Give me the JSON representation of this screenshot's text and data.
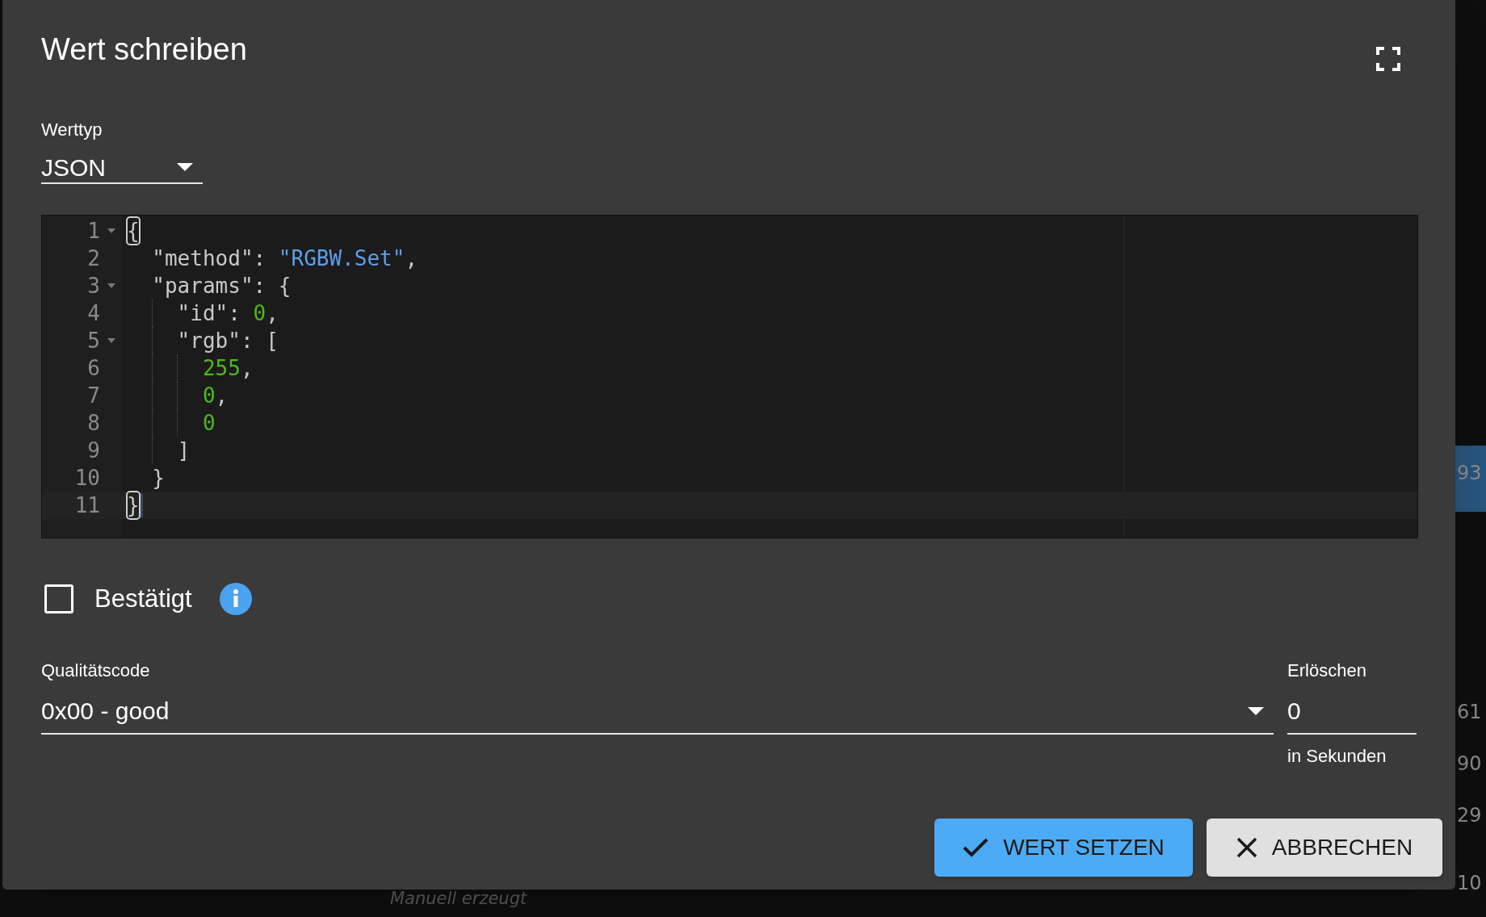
{
  "background": {
    "row_values": [
      "93",
      "61",
      "90",
      "29",
      "10"
    ],
    "caption": "Manuell erzeugt"
  },
  "dialog": {
    "title": "Wert schreiben",
    "value_type": {
      "label": "Werttyp",
      "value": "JSON"
    },
    "editor": {
      "lines": [
        {
          "number": "1",
          "foldable": true,
          "active": false,
          "tokens": [
            {
              "kind": "matched-bracket",
              "text": "{"
            }
          ]
        },
        {
          "number": "2",
          "foldable": false,
          "active": false,
          "tokens": [
            {
              "kind": "plain",
              "text": "  \"method\": "
            },
            {
              "kind": "string",
              "text": "\"RGBW.Set\""
            },
            {
              "kind": "plain",
              "text": ","
            }
          ]
        },
        {
          "number": "3",
          "foldable": true,
          "active": false,
          "tokens": [
            {
              "kind": "plain",
              "text": "  \"params\": {"
            }
          ]
        },
        {
          "number": "4",
          "foldable": false,
          "active": false,
          "tokens": [
            {
              "kind": "plain",
              "text": "    \"id\": "
            },
            {
              "kind": "number",
              "text": "0"
            },
            {
              "kind": "plain",
              "text": ","
            }
          ]
        },
        {
          "number": "5",
          "foldable": true,
          "active": false,
          "tokens": [
            {
              "kind": "plain",
              "text": "    \"rgb\": ["
            }
          ]
        },
        {
          "number": "6",
          "foldable": false,
          "active": false,
          "tokens": [
            {
              "kind": "number",
              "text": "      255"
            },
            {
              "kind": "plain",
              "text": ","
            }
          ]
        },
        {
          "number": "7",
          "foldable": false,
          "active": false,
          "tokens": [
            {
              "kind": "number",
              "text": "      0"
            },
            {
              "kind": "plain",
              "text": ","
            }
          ]
        },
        {
          "number": "8",
          "foldable": false,
          "active": false,
          "tokens": [
            {
              "kind": "number",
              "text": "      0"
            }
          ]
        },
        {
          "number": "9",
          "foldable": false,
          "active": false,
          "tokens": [
            {
              "kind": "plain",
              "text": "    ]"
            }
          ]
        },
        {
          "number": "10",
          "foldable": false,
          "active": false,
          "tokens": [
            {
              "kind": "plain",
              "text": "  }"
            }
          ]
        },
        {
          "number": "11",
          "foldable": false,
          "active": true,
          "tokens": [
            {
              "kind": "matched-bracket",
              "text": "}"
            }
          ]
        }
      ]
    },
    "acknowledged": {
      "label": "Bestätigt",
      "checked": false
    },
    "quality": {
      "label": "Qualitätscode",
      "value": "0x00 - good"
    },
    "expire": {
      "label": "Erlöschen",
      "value": "0",
      "helper": "in Sekunden"
    },
    "buttons": [
      {
        "kind": "primary",
        "label": "WERT SETZEN"
      },
      {
        "kind": "secondary",
        "label": "ABBRECHEN"
      }
    ]
  }
}
